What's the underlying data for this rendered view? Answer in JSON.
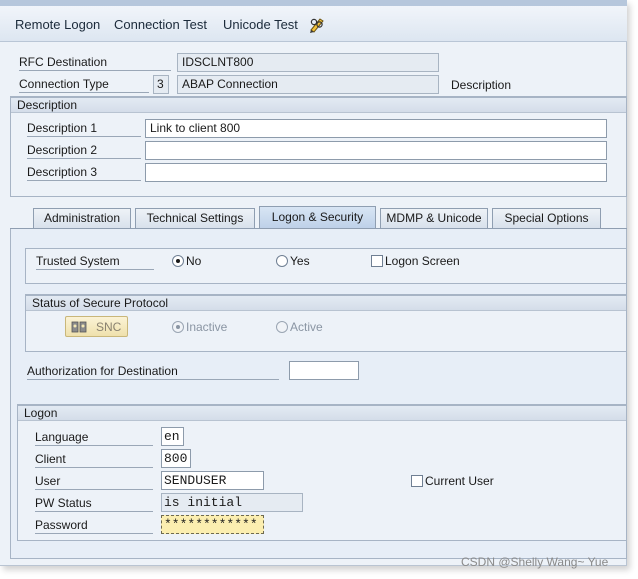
{
  "toolbar": {
    "remote_logon": "Remote Logon",
    "connection_test": "Connection Test",
    "unicode_test": "Unicode Test",
    "edit_icon": "pencil-glasses-icon"
  },
  "header": {
    "rfc_destination_label": "RFC Destination",
    "rfc_destination_value": "IDSCLNT800",
    "connection_type_label": "Connection Type",
    "connection_type_code": "3",
    "connection_type_value": "ABAP Connection",
    "description_link": "Description"
  },
  "description": {
    "group_title": "Description",
    "desc1_label": "Description 1",
    "desc1_value": "Link to client 800",
    "desc2_label": "Description 2",
    "desc2_value": "",
    "desc3_label": "Description 3",
    "desc3_value": ""
  },
  "tabs": [
    {
      "label": "Administration"
    },
    {
      "label": "Technical Settings"
    },
    {
      "label": "Logon & Security"
    },
    {
      "label": "MDMP & Unicode"
    },
    {
      "label": "Special Options"
    }
  ],
  "security": {
    "trusted_system_label": "Trusted System",
    "no_label": "No",
    "yes_label": "Yes",
    "logon_screen_label": "Logon Screen",
    "secure_protocol_title": "Status of Secure Protocol",
    "snc_label": "SNC",
    "inactive_label": "Inactive",
    "active_label": "Active",
    "authorization_label": "Authorization for Destination",
    "authorization_value": ""
  },
  "logon": {
    "group_title": "Logon",
    "language_label": "Language",
    "language_value": "en",
    "client_label": "Client",
    "client_value": "800",
    "user_label": "User",
    "user_value": "SENDUSER",
    "current_user_label": "Current User",
    "pw_status_label": "PW Status",
    "pw_status_value": "is initial",
    "password_label": "Password",
    "password_value": "************"
  },
  "watermark": "CSDN @Shelly Wang~ Yue",
  "colors": {
    "background": "#edf2f8",
    "toolbar": "#dde6f1",
    "active_tab": "#bdd0e8",
    "password_highlight": "#fbeeb0"
  }
}
